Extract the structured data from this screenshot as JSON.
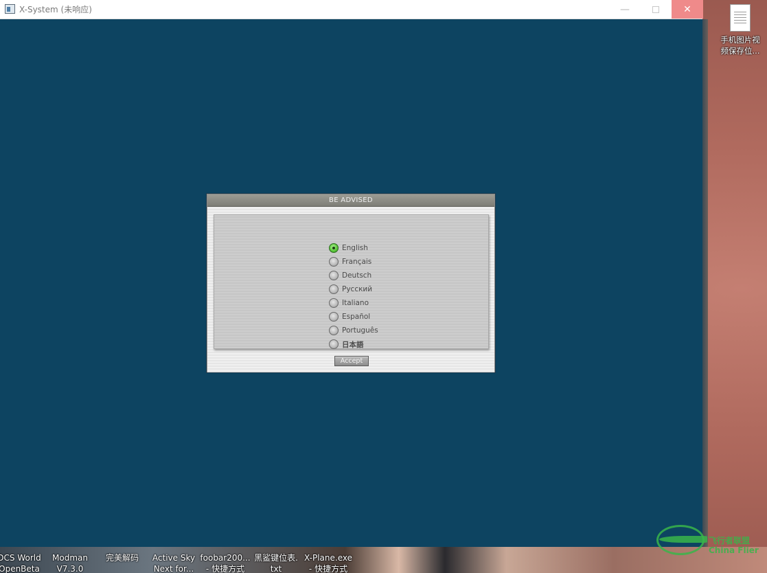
{
  "window": {
    "title": "X-System (未响应)",
    "minimize_glyph": "—",
    "close_glyph": "✕"
  },
  "dialog": {
    "header": "BE ADVISED",
    "languages": [
      {
        "label": "English",
        "selected": true
      },
      {
        "label": "Français",
        "selected": false
      },
      {
        "label": "Deutsch",
        "selected": false
      },
      {
        "label": "Русский",
        "selected": false
      },
      {
        "label": "Italiano",
        "selected": false
      },
      {
        "label": "Español",
        "selected": false
      },
      {
        "label": "Português",
        "selected": false
      },
      {
        "label": "日本語",
        "selected": false
      }
    ],
    "accept_label": "Accept"
  },
  "desktop": {
    "file_icon": {
      "line1": "手机图片视",
      "line2": "频保存位..."
    },
    "taskbar_icons": [
      {
        "line1": "DCS World",
        "line2": "OpenBeta"
      },
      {
        "line1": "Modman",
        "line2": "V7.3.0"
      },
      {
        "line1": "完美解码",
        "line2": ""
      },
      {
        "line1": "Active Sky",
        "line2": "Next for..."
      },
      {
        "line1": "foobar200...",
        "line2": "- 快捷方式"
      },
      {
        "line1": "黑鲨键位表.",
        "line2": "txt"
      },
      {
        "line1": "X-Plane.exe",
        "line2": "- 快捷方式"
      }
    ]
  },
  "watermark": {
    "cn": "飞行者联盟",
    "en": "China Flier"
  },
  "colors": {
    "app_background": "#0d4461",
    "radio_selected": "#5cc83a",
    "close_button": "#ef8a8a"
  }
}
